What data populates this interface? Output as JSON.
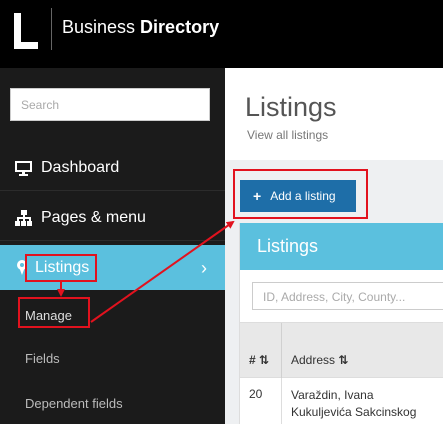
{
  "app": {
    "title_plain": "Business ",
    "title_bold": "Directory"
  },
  "sidebar": {
    "search_placeholder": "Search",
    "items": [
      {
        "label": "Dashboard",
        "icon": "monitor-icon"
      },
      {
        "label": "Pages & menu",
        "icon": "sitemap-icon"
      },
      {
        "label": "Listings",
        "icon": "map-marker-icon",
        "active": true
      }
    ],
    "submenu": [
      {
        "label": "Manage"
      },
      {
        "label": "Fields"
      },
      {
        "label": "Dependent fields"
      }
    ]
  },
  "main": {
    "title": "Listings",
    "subtitle": "View all listings",
    "add_button_label": "Add a listing",
    "panel": {
      "heading": "Listings",
      "filter_placeholder": "ID, Address, City, County...",
      "columns": [
        "#",
        "Address"
      ],
      "rows": [
        {
          "id": "20",
          "address_line1": "Varaždin, Ivana",
          "address_line2": "Kukuljevića Sakcinskog"
        }
      ]
    }
  },
  "colors": {
    "accent": "#5bc0de",
    "button": "#1e6ea8",
    "annotation": "#e2121e"
  }
}
